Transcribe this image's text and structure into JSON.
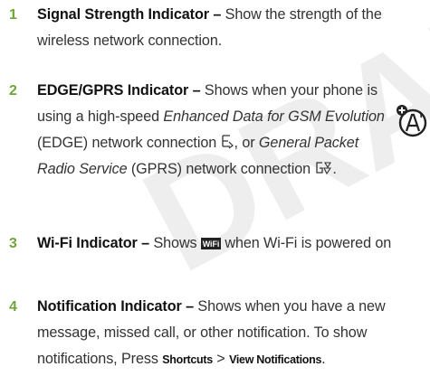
{
  "items": [
    {
      "number": "1",
      "term": "Signal Strength Indicator –",
      "text": " Show the strength of the wireless network connection."
    },
    {
      "number": "2",
      "term": "EDGE/GPRS Indicator –",
      "text_a": " Shows when your phone is using a high-speed ",
      "em_a": "Enhanced Data for GSM Evolution",
      "text_b": " (EDGE) network connection ",
      "text_c": ", or ",
      "em_b": "General Packet Radio Service",
      "text_d": " (GPRS) network connection ",
      "text_e": "."
    },
    {
      "number": "3",
      "term": "Wi-Fi Indicator –",
      "text_a": " Shows ",
      "text_b": " when Wi-Fi is powered on"
    },
    {
      "number": "4",
      "term": "Notification Indicator –",
      "text_a": " Shows when you have a new message, missed call, or other notification. To show notifications, Press ",
      "key_a": "Shortcuts",
      "sep": " > ",
      "key_b": "View Notifications",
      "text_b": "."
    }
  ],
  "watermark": "DRAFT",
  "colors": {
    "number": "#6fa63a",
    "watermark": "#eeeeee"
  },
  "icons": {
    "side": "accessibility-a-icon",
    "edge": "edge-network-icon",
    "gprs": "gprs-network-icon",
    "wifi": "wifi-status-icon"
  }
}
